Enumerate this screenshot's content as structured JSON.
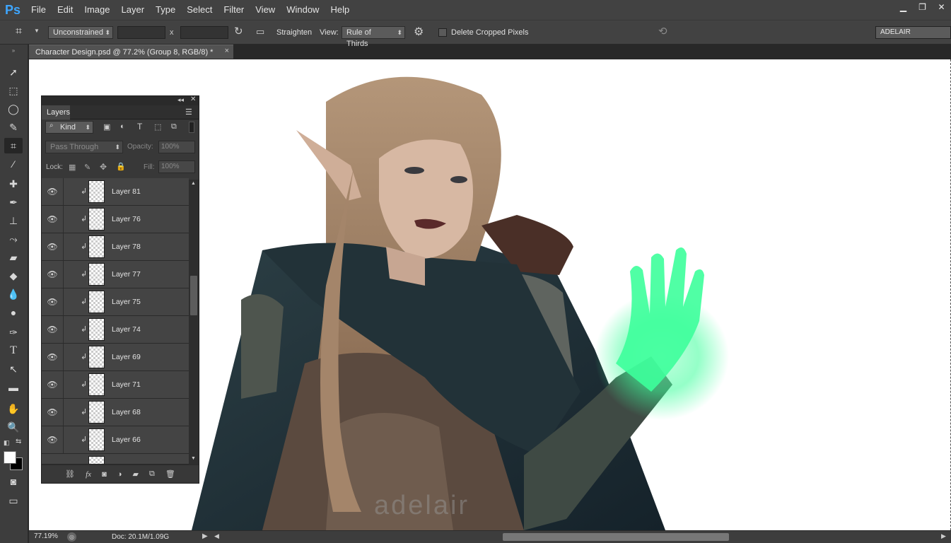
{
  "app": {
    "logo": "Ps"
  },
  "menu": [
    "File",
    "Edit",
    "Image",
    "Layer",
    "Type",
    "Select",
    "Filter",
    "View",
    "Window",
    "Help"
  ],
  "options_bar": {
    "ratio_select": "Unconstrained",
    "x_separator": "x",
    "straighten_label": "Straighten",
    "view_label": "View:",
    "view_select": "Rule of Thirds",
    "delete_cropped_label": "Delete Cropped Pixels",
    "workspace_name": "ADELAIR"
  },
  "document": {
    "tab_title": "Character Design.psd @ 77.2% (Group 8, RGB/8) *",
    "close_glyph": "×",
    "watermark": "adelair"
  },
  "status": {
    "zoom": "77.19%",
    "doc_size": "Doc: 20.1M/1.09G"
  },
  "layers_panel": {
    "tab_label": "Layers",
    "filter_kind": "Kind",
    "blend_mode": "Pass Through",
    "opacity_label": "Opacity:",
    "opacity_value": "100%",
    "lock_label": "Lock:",
    "fill_label": "Fill:",
    "fill_value": "100%",
    "layers": [
      {
        "name": "Layer 81"
      },
      {
        "name": "Layer 76"
      },
      {
        "name": "Layer 78"
      },
      {
        "name": "Layer 77"
      },
      {
        "name": "Layer 75"
      },
      {
        "name": "Layer 74"
      },
      {
        "name": "Layer 69"
      },
      {
        "name": "Layer 71"
      },
      {
        "name": "Layer 68"
      },
      {
        "name": "Layer 66"
      }
    ]
  },
  "colors": {
    "accent_glow": "#3dff9b",
    "cloak": "#1f2f35",
    "hair": "#a88a6e",
    "skin": "#d7b8a3"
  }
}
